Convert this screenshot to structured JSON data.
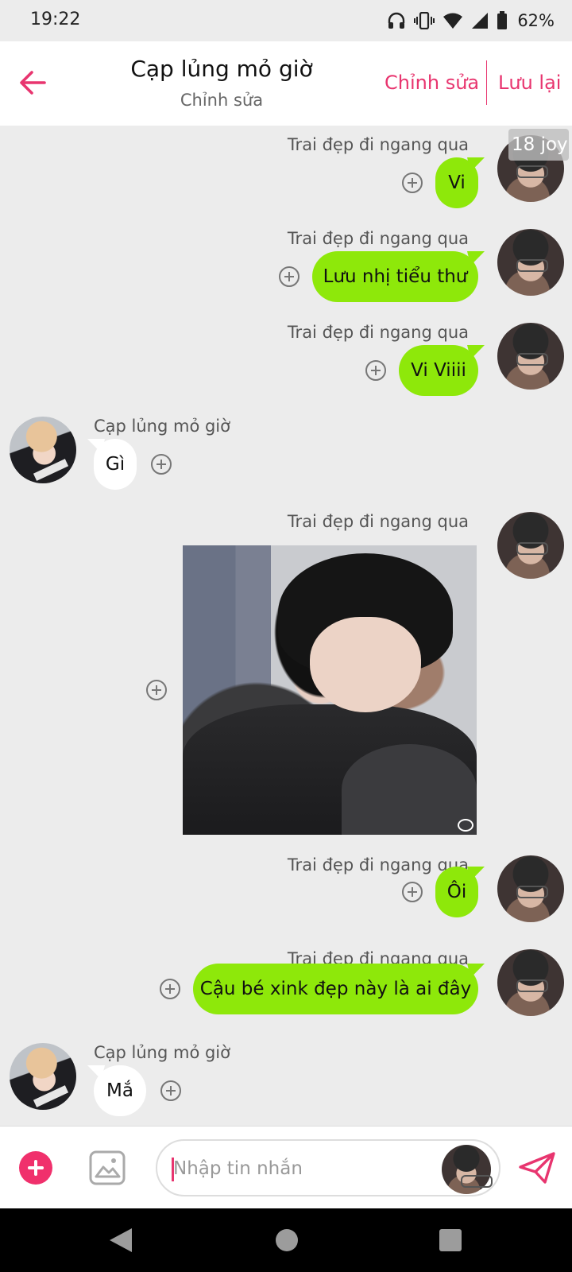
{
  "status_bar": {
    "time": "19:22",
    "battery": "62%"
  },
  "header": {
    "title": "Cạp lủng mỏ giờ",
    "subtitle": "Chỉnh sửa",
    "edit_label": "Chỉnh sửa",
    "save_label": "Lưu lại"
  },
  "badge": "18 joy",
  "messages": [
    {
      "sender": "Trai đẹp đi ngang qua",
      "text": "Vi",
      "side": "right"
    },
    {
      "sender": "Trai đẹp đi ngang qua",
      "text": "Lưu nhị tiểu thư",
      "side": "right"
    },
    {
      "sender": "Trai đẹp đi ngang qua",
      "text": "Vi Viiii",
      "side": "right"
    },
    {
      "sender": "Cạp lủng mỏ giờ",
      "text": "Gì",
      "side": "left"
    },
    {
      "sender": "Trai đẹp đi ngang qua",
      "text": "",
      "side": "right",
      "type": "image"
    },
    {
      "sender": "Trai đẹp đi ngang qua",
      "text": "Ôi",
      "side": "right"
    },
    {
      "sender": "Trai đẹp đi ngang qua",
      "text": "Cậu bé xink đẹp này là ai đây",
      "side": "right"
    },
    {
      "sender": "Cạp lủng mỏ giờ",
      "text": "Mắ",
      "side": "left"
    }
  ],
  "input": {
    "placeholder": "Nhập tin nhắn"
  },
  "colors": {
    "accent": "#e8356f",
    "bubble_self": "#8ee80a",
    "bubble_other": "#ffffff",
    "chat_background": "#ececec"
  },
  "icons": [
    "back-arrow-icon",
    "plus-circle-icon",
    "image-icon",
    "send-icon",
    "headphones-icon",
    "vibrate-icon",
    "wifi-icon",
    "signal-icon",
    "battery-icon"
  ]
}
